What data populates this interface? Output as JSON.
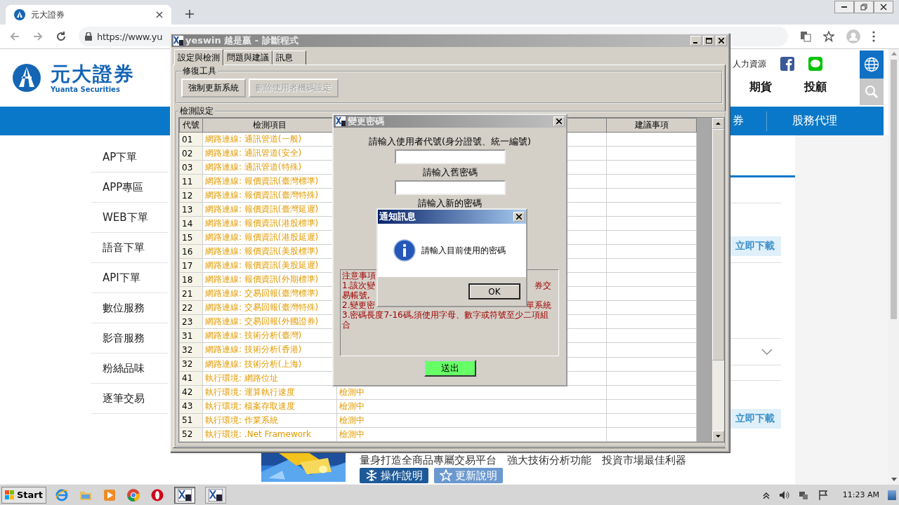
{
  "browser": {
    "tab_title": "元大證券",
    "url": "https://www.yu"
  },
  "site": {
    "logo_text": "元大證券",
    "logo_subtitle": "Yuanta Securities",
    "top_links": [
      "人力資源"
    ],
    "main_nav": [
      "期貨",
      "投顧"
    ],
    "blue_nav": [
      "券",
      "股務代理"
    ],
    "sidebar": [
      "AP下單",
      "APP專區",
      "WEB下單",
      "語音下單",
      "API下單",
      "數位服務",
      "影音服務",
      "粉絲品味",
      "逐筆交易"
    ],
    "download_buttons": [
      "立即下載",
      "立即下載"
    ],
    "product_tagline": "量身打造全商品專屬交易平台　強大技術分析功能　投資市場最佳利器",
    "product_buttons": [
      {
        "label": "操作說明",
        "kind": "manual"
      },
      {
        "label": "更新說明",
        "kind": "update"
      }
    ]
  },
  "diag_window": {
    "title": "yeswin 越是贏 - 診斷程式",
    "tabs": [
      {
        "label": "設定與檢測",
        "selected": true
      },
      {
        "label": "問題與建議",
        "selected": false
      },
      {
        "label": "訊息",
        "selected": false
      }
    ],
    "repair_group": {
      "title": "修復工具",
      "buttons": [
        {
          "label": "強制更新系統",
          "disabled": false
        },
        {
          "label": "刪除使用者機碼設定",
          "disabled": true
        }
      ]
    },
    "check_group": {
      "title": "檢測設定",
      "columns": [
        "代號",
        "檢測項目",
        "建議事項"
      ],
      "rows": [
        {
          "code": "01",
          "item": "網路連線: 通訊管道(一般)"
        },
        {
          "code": "02",
          "item": "網路連線: 通訊管道(安全)"
        },
        {
          "code": "03",
          "item": "網路連線: 通訊管道(特殊)"
        },
        {
          "code": "11",
          "item": "網路連線: 報價資訊(臺灣標準)"
        },
        {
          "code": "12",
          "item": "網路連線: 報價資訊(臺灣特殊)"
        },
        {
          "code": "13",
          "item": "網路連線: 報價資訊(臺灣延遲)"
        },
        {
          "code": "14",
          "item": "網路連線: 報價資訊(港股標準)"
        },
        {
          "code": "15",
          "item": "網路連線: 報價資訊(港股延遲)"
        },
        {
          "code": "16",
          "item": "網路連線: 報價資訊(美股標準)"
        },
        {
          "code": "17",
          "item": "網路連線: 報價資訊(美股延遲)"
        },
        {
          "code": "18",
          "item": "網路連線: 報價資訊(外期標準)"
        },
        {
          "code": "21",
          "item": "網路連線: 交易回報(臺灣標準)"
        },
        {
          "code": "22",
          "item": "網路連線: 交易回報(臺灣特殊)"
        },
        {
          "code": "23",
          "item": "網路連線: 交易回報(外國證券)"
        },
        {
          "code": "31",
          "item": "網路連線: 技術分析(臺灣)"
        },
        {
          "code": "32",
          "item": "網路連線: 技術分析(香港)"
        },
        {
          "code": "32",
          "item": "網路連線: 技術分析(上海)"
        },
        {
          "code": "41",
          "item": "執行環境: 網路位址"
        },
        {
          "code": "42",
          "item": "執行環境: 運算執行速度",
          "status": "檢測中"
        },
        {
          "code": "43",
          "item": "執行環境: 檔案存取速度",
          "status": "檢測中"
        },
        {
          "code": "51",
          "item": "執行環境: 作業系統",
          "status": "檢測中"
        },
        {
          "code": "52",
          "item": "執行環境: .Net Framework",
          "status": "檢測中"
        }
      ]
    }
  },
  "password_dialog": {
    "title": "變更密碼",
    "fields": [
      {
        "label": "請輸入使用者代號(身分證號、統一編號)",
        "input_shown": true
      },
      {
        "label": "請輸入舊密碼",
        "input_shown": true
      },
      {
        "label": "請輸入新的密碼",
        "input_shown": false
      }
    ],
    "notes": [
      {
        "left": "注意事項"
      },
      {
        "left": "1.該次變",
        "right": "券交"
      },
      {
        "left": "易帳號,"
      },
      {
        "left": "2.變更密",
        "right": "單系統"
      },
      {
        "left": "3.密碼長度7-16碼,須使用字母、數字或符號至少二項組"
      },
      {
        "left": "合"
      }
    ],
    "submit": "送出"
  },
  "message_box": {
    "title": "通知訊息",
    "message": "請輸入目前使用的密碼",
    "button": "OK"
  },
  "taskbar": {
    "start": "Start",
    "quick_launch": [
      {
        "kind": "ie"
      },
      {
        "kind": "folder"
      },
      {
        "kind": "media"
      },
      {
        "kind": "chrome"
      },
      {
        "kind": "opera"
      }
    ],
    "tasks": [
      {
        "selected": true
      },
      {
        "selected": false
      }
    ],
    "clock": "11:23 AM"
  }
}
